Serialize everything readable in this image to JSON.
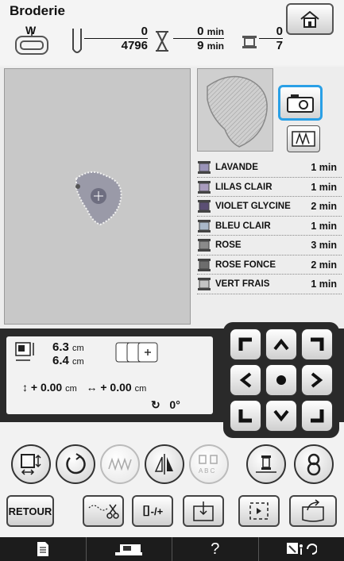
{
  "header": {
    "title": "Broderie",
    "home_icon": "home-icon"
  },
  "status": {
    "frame_label": "W",
    "stitch_current": "0",
    "stitch_total": "4796",
    "time_current": "0",
    "time_total": "9",
    "time_unit": "min",
    "color_current": "0",
    "color_total": "7"
  },
  "threads": [
    {
      "name": "LAVANDE",
      "time": "1 min",
      "color": "#9a93b8"
    },
    {
      "name": "LILAS CLAIR",
      "time": "1 min",
      "color": "#a99bbd"
    },
    {
      "name": "VIOLET GLYCINE",
      "time": "2 min",
      "color": "#5b4f74"
    },
    {
      "name": "BLEU CLAIR",
      "time": "1 min",
      "color": "#a9b8c9"
    },
    {
      "name": "ROSE",
      "time": "3 min",
      "color": "#8a8a8a"
    },
    {
      "name": "ROSE FONCE",
      "time": "2 min",
      "color": "#6d6d6d"
    },
    {
      "name": "VERT FRAIS",
      "time": "1 min",
      "color": "#c4c4c4"
    }
  ],
  "size": {
    "height": "6.3",
    "width": "6.4",
    "unit": "cm"
  },
  "offset": {
    "y_value": "+ 0.00",
    "x_value": "+ 0.00",
    "unit": "cm"
  },
  "rotation": {
    "value": "0°"
  },
  "buttons": {
    "back_label": "RETOUR",
    "needle_adjust_label": "-/+"
  },
  "footer": {
    "help_label": "?"
  }
}
